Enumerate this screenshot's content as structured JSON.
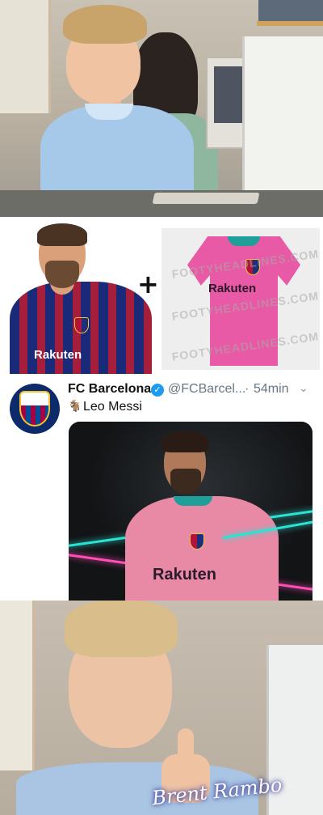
{
  "meme": {
    "panel_top": {
      "description_free": true
    },
    "kit_comparison": {
      "plus_symbol": "+",
      "messi_shirt_sponsor": "Rakuten",
      "kit_sponsor": "Rakuten",
      "watermarks": [
        "FOOTYHEADLINES.COM",
        "FOOTYHEADLINES.COM",
        "FOOTYHEADLINES.COM"
      ]
    },
    "tweet": {
      "account_name": "FC Barcelona",
      "handle": "@FCBarcel...",
      "separator": "·",
      "time": "54min",
      "emoji": "🐐",
      "text": "Leo Messi",
      "media_sponsor": "Rakuten"
    },
    "bottom_panel": {
      "signature": "Brent Rambo"
    }
  }
}
